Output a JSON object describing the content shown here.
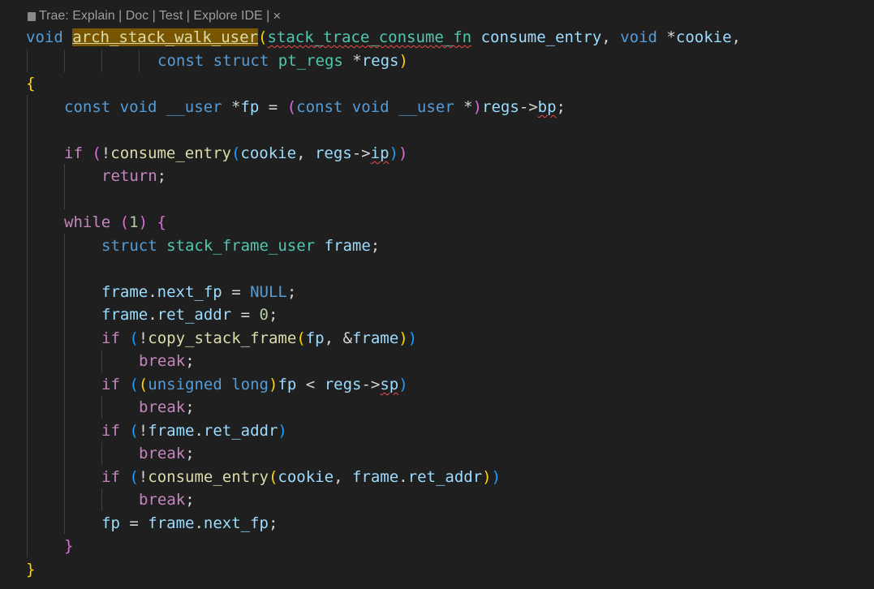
{
  "codelens": {
    "text": "Trae: Explain | Doc | Test | Explore IDE |",
    "close_icon": "close-icon",
    "doc_icon": "codelens-icon"
  },
  "code": {
    "l1": {
      "kw_void": "void",
      "fn_name": "arch_stack_walk_user",
      "paren": "(",
      "type_cb": "stack_trace_consume_fn",
      "p1": "consume_entry",
      "comma": ",",
      "kw_void2": "void",
      "star": "*",
      "p2": "cookie",
      "comma2": ","
    },
    "l2": {
      "kw_const": "const",
      "kw_struct": "struct",
      "type_regs": "pt_regs",
      "star": "*",
      "p3": "regs",
      "close": ")"
    },
    "l3": {
      "brace": "{"
    },
    "l4": {
      "kw_const": "const",
      "kw_void": "void",
      "kw_user": "__user",
      "star": "*",
      "v_fp": "fp",
      "eq": "=",
      "paren_open": "(",
      "kw_const2": "const",
      "kw_void2": "void",
      "kw_user2": "__user",
      "star2": "*",
      "paren_close": ")",
      "v_regs": "regs",
      "arrow": "->",
      "v_bp": "bp",
      "semi": ";"
    },
    "l6": {
      "kw_if": "if",
      "paren_open": "(",
      "bang": "!",
      "fn": "consume_entry",
      "inner_open": "(",
      "a1": "cookie",
      "comma": ",",
      "a2": "regs",
      "arrow": "->",
      "a3": "ip",
      "inner_close": ")",
      "paren_close": ")"
    },
    "l7": {
      "kw_return": "return",
      "semi": ";"
    },
    "l9": {
      "kw_while": "while",
      "paren_open": "(",
      "num": "1",
      "paren_close": ")",
      "brace": "{"
    },
    "l10": {
      "kw_struct": "struct",
      "type": "stack_frame_user",
      "var": "frame",
      "semi": ";"
    },
    "l12": {
      "v1": "frame",
      "dot": ".",
      "v2": "next_fp",
      "eq": "=",
      "null": "NULL",
      "semi": ";"
    },
    "l13": {
      "v1": "frame",
      "dot": ".",
      "v2": "ret_addr",
      "eq": "=",
      "num": "0",
      "semi": ";"
    },
    "l14": {
      "kw_if": "if",
      "paren_open": "(",
      "bang": "!",
      "fn": "copy_stack_frame",
      "inner_open": "(",
      "a1": "fp",
      "comma": ",",
      "amp": "&",
      "a2": "frame",
      "inner_close": ")",
      "paren_close": ")"
    },
    "l15": {
      "kw_break": "break",
      "semi": ";"
    },
    "l16": {
      "kw_if": "if",
      "paren_open": "(",
      "inner_open": "(",
      "kw_unsigned": "unsigned",
      "kw_long": "long",
      "inner_close": ")",
      "a1": "fp",
      "lt": "<",
      "a2": "regs",
      "arrow": "->",
      "a3": "sp",
      "paren_close": ")"
    },
    "l17": {
      "kw_break": "break",
      "semi": ";"
    },
    "l18": {
      "kw_if": "if",
      "paren_open": "(",
      "bang": "!",
      "v1": "frame",
      "dot": ".",
      "v2": "ret_addr",
      "paren_close": ")"
    },
    "l19": {
      "kw_break": "break",
      "semi": ";"
    },
    "l20": {
      "kw_if": "if",
      "paren_open": "(",
      "bang": "!",
      "fn": "consume_entry",
      "inner_open": "(",
      "a1": "cookie",
      "comma": ",",
      "a2": "frame",
      "dot": ".",
      "a3": "ret_addr",
      "inner_close": ")",
      "paren_close": ")"
    },
    "l21": {
      "kw_break": "break",
      "semi": ";"
    },
    "l22": {
      "v1": "fp",
      "eq": "=",
      "v2": "frame",
      "dot": ".",
      "v3": "next_fp",
      "semi": ";"
    },
    "l23": {
      "brace": "}"
    },
    "l24": {
      "brace": "}"
    }
  },
  "colors": {
    "background": "#1f1f1f",
    "keyword": "#569cd6",
    "control": "#c586c0",
    "type": "#4ec9b0",
    "variable": "#9cdcfe",
    "function": "#dcdcaa",
    "number": "#b5cea8",
    "highlight": "#7a5500",
    "error_squiggle": "#f14c4c"
  }
}
